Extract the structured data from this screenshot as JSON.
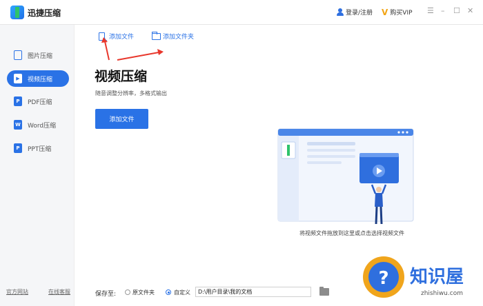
{
  "app": {
    "title": "迅捷压缩"
  },
  "header": {
    "login_label": "登录/注册",
    "vip_label": "购买VIP"
  },
  "window_controls": [
    "menu-icon",
    "minimize-icon",
    "maximize-icon",
    "close-icon"
  ],
  "sidebar": {
    "items": [
      {
        "label": "图片压缩",
        "icon": "image-icon",
        "active": false
      },
      {
        "label": "视频压缩",
        "icon": "video-icon",
        "active": true
      },
      {
        "label": "PDF压缩",
        "icon": "pdf-icon",
        "active": false
      },
      {
        "label": "Word压缩",
        "icon": "word-icon",
        "active": false
      },
      {
        "label": "PPT压缩",
        "icon": "ppt-icon",
        "active": false
      }
    ],
    "bottom_links": [
      "官方网站",
      "在线客服"
    ]
  },
  "toolbar": {
    "add_file": "添加文件",
    "add_folder": "添加文件夹"
  },
  "main": {
    "title": "视频压缩",
    "subtitle": "随意调整分辨率，多格式输出",
    "add_button": "添加文件",
    "drop_hint": "将视频文件拖放到这里或点击选择视频文件"
  },
  "save": {
    "label": "保存至:",
    "option_original": "原文件夹",
    "option_custom": "自定义",
    "selected": "自定义",
    "path": "D:\\用户目录\\我的文档"
  },
  "watermark": {
    "text": "知识屋",
    "url": "zhishiwu.com"
  },
  "colors": {
    "accent": "#2a72e6",
    "sidebar_bg": "#f5f6f8",
    "annotation_arrow": "#e8372c"
  }
}
